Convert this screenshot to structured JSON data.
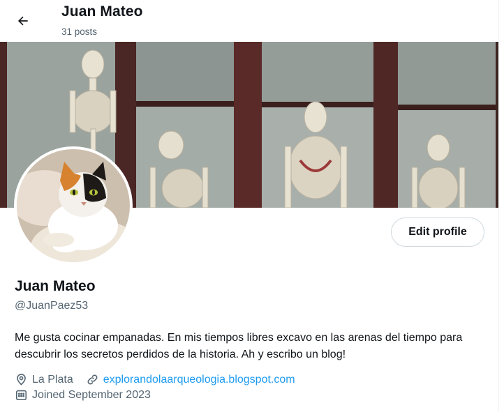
{
  "header": {
    "name": "Juan Mateo",
    "posts_count": "31 posts",
    "back_icon": "arrow-left-icon"
  },
  "profile": {
    "display_name": "Juan Mateo",
    "handle": "@JuanPaez53",
    "bio": "Me gusta cocinar empanadas. En mis tiempos libres excavo en las arenas del tiempo para descubrir los secretos perdidos de la historia. Ah y escribo un blog!",
    "location": "La Plata",
    "website": "explorandolaarqueologia.blogspot.com",
    "joined": "Joined September 2023",
    "edit_button_label": "Edit profile"
  },
  "icons": {
    "location": "location-pin-icon",
    "link": "link-icon",
    "calendar": "calendar-icon"
  },
  "colors": {
    "link": "#1d9bf0",
    "secondary_text": "#536471",
    "primary_text": "#0f1419",
    "border": "#cfd9de"
  }
}
